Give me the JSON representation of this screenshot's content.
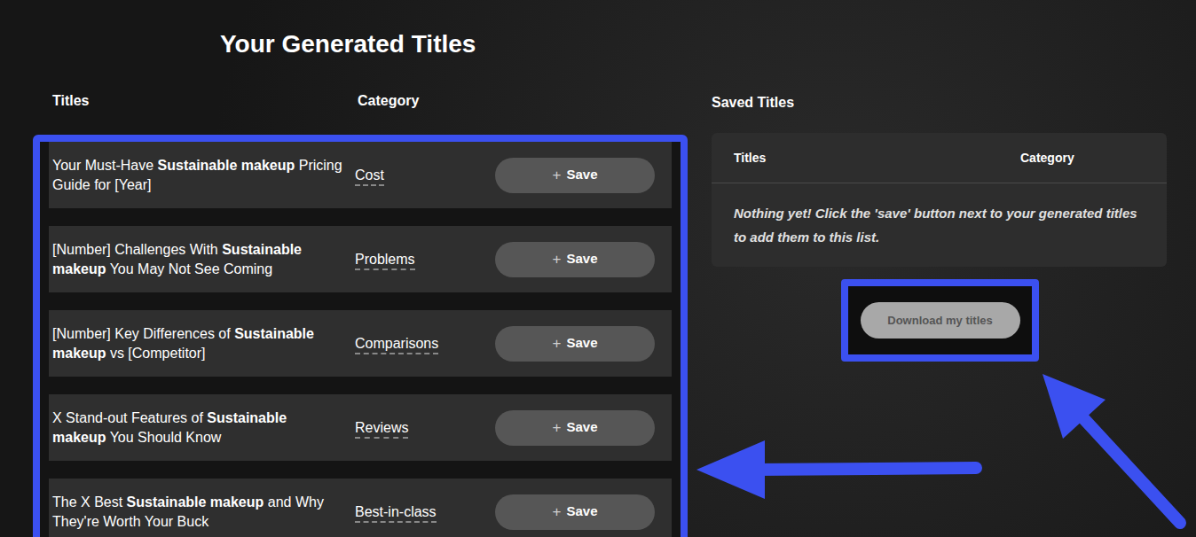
{
  "page": {
    "title": "Your Generated Titles"
  },
  "generated": {
    "columns": [
      "Titles",
      "Category"
    ],
    "rows": [
      {
        "title": {
          "before": "Your Must-Have ",
          "bold": "Sustainable makeup",
          "after": " Pricing Guide for [Year]"
        },
        "category": "Cost",
        "save_button": {
          "icon": "+",
          "label": "Save"
        }
      },
      {
        "title": {
          "before": "[Number] Challenges With ",
          "bold": "Sustainable makeup",
          "after": " You May Not See Coming"
        },
        "category": "Problems",
        "save_button": {
          "icon": "+",
          "label": "Save"
        }
      },
      {
        "title": {
          "before": "[Number] Key Differences of ",
          "bold": "Sustainable makeup",
          "after": " vs [Competitor]"
        },
        "category": "Comparisons",
        "save_button": {
          "icon": "+",
          "label": "Save"
        }
      },
      {
        "title": {
          "before": "X Stand-out Features of ",
          "bold": "Sustainable makeup",
          "after": " You Should Know"
        },
        "category": "Reviews",
        "save_button": {
          "icon": "+",
          "label": "Save"
        }
      },
      {
        "title": {
          "before": "The X Best ",
          "bold": "Sustainable makeup",
          "after": " and Why They're Worth Your Buck"
        },
        "category": "Best-in-class",
        "save_button": {
          "icon": "+",
          "label": "Save"
        }
      }
    ]
  },
  "saved": {
    "heading": "Saved Titles",
    "columns": [
      "Titles",
      "Category"
    ],
    "empty_message": "Nothing yet! Click the 'save' button next to your generated titles to add them to this list.",
    "download_button": "Download my titles"
  }
}
